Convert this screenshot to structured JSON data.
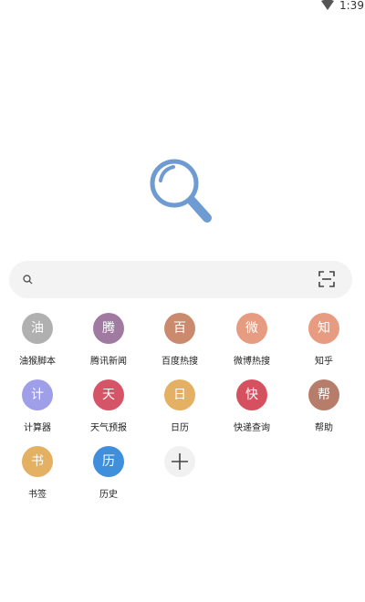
{
  "status_bar": {
    "time": "1:39"
  },
  "shortcuts": [
    {
      "icon_char": "油",
      "label": "油猴脚本",
      "color": "#b0b0b0"
    },
    {
      "icon_char": "腾",
      "label": "腾讯新闻",
      "color": "#a07aa0"
    },
    {
      "icon_char": "百",
      "label": "百度热搜",
      "color": "#c98a6e"
    },
    {
      "icon_char": "微",
      "label": "微博热搜",
      "color": "#e59c80"
    },
    {
      "icon_char": "知",
      "label": "知乎",
      "color": "#e79b80"
    },
    {
      "icon_char": "计",
      "label": "计算器",
      "color": "#9f9ee8"
    },
    {
      "icon_char": "天",
      "label": "天气预报",
      "color": "#d55468"
    },
    {
      "icon_char": "日",
      "label": "日历",
      "color": "#e4b164"
    },
    {
      "icon_char": "快",
      "label": "快递查询",
      "color": "#d6515f"
    },
    {
      "icon_char": "帮",
      "label": "帮助",
      "color": "#b67d6a"
    },
    {
      "icon_char": "书",
      "label": "书签",
      "color": "#e4b062"
    },
    {
      "icon_char": "历",
      "label": "历史",
      "color": "#3f8fdc"
    }
  ],
  "colors": {
    "logo": "#6f9bd3",
    "search_bg": "#f3f3f3"
  },
  "icons": [
    "wifi-icon",
    "search-icon",
    "scan-icon",
    "plus-icon",
    "magnifier-logo"
  ]
}
